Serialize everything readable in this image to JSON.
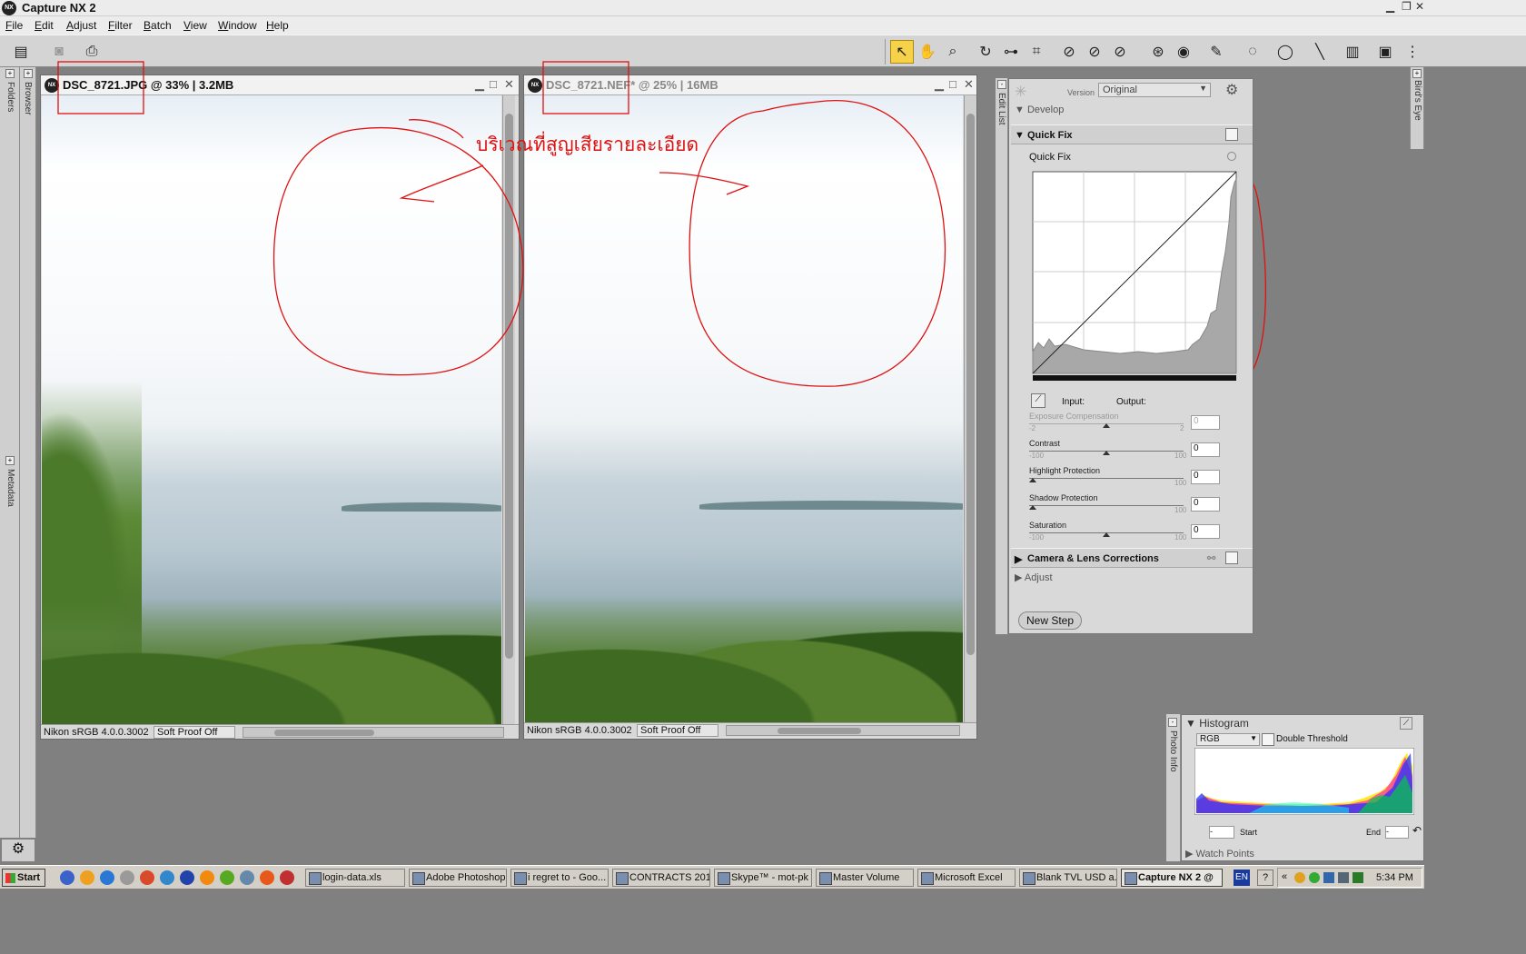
{
  "app": {
    "title": "Capture NX 2"
  },
  "menu": [
    "File",
    "Edit",
    "Adjust",
    "Filter",
    "Batch",
    "View",
    "Window",
    "Help"
  ],
  "side_panels": {
    "folders": "Folders",
    "browser": "Browser",
    "metadata": "Metadata",
    "edit_list": "Edit List",
    "birds_eye": "Bird's Eye",
    "photo_info": "Photo Info"
  },
  "window1": {
    "title": "DSC_8721.JPG @ 33% | 3.2MB",
    "profile": "Nikon sRGB 4.0.0.3002",
    "soft_proof": "Soft Proof Off"
  },
  "window2": {
    "title": "DSC_8721.NEF* @ 25% | 16MB",
    "profile": "Nikon sRGB 4.0.0.3002",
    "soft_proof": "Soft Proof Off"
  },
  "annotation_text": "บริเวณที่สูญเสียรายละเอียด",
  "edit": {
    "version_label": "Version",
    "version_value": "Original",
    "develop": "Develop",
    "quick_fix_header": "Quick Fix",
    "quick_fix_sub": "Quick Fix",
    "input_label": "Input:",
    "output_label": "Output:",
    "sliders": [
      {
        "label": "Exposure Compensation",
        "min": "-2",
        "max": "2",
        "value": "0",
        "pos": 0.5,
        "disabled": true
      },
      {
        "label": "Contrast",
        "min": "-100",
        "max": "100",
        "value": "0",
        "pos": 0.5,
        "disabled": false
      },
      {
        "label": "Highlight Protection",
        "min": "",
        "max": "100",
        "value": "0",
        "pos": 0.0,
        "disabled": false
      },
      {
        "label": "Shadow Protection",
        "min": "",
        "max": "100",
        "value": "0",
        "pos": 0.0,
        "disabled": false
      },
      {
        "label": "Saturation",
        "min": "-100",
        "max": "100",
        "value": "0",
        "pos": 0.5,
        "disabled": false
      }
    ],
    "camera_lens": "Camera & Lens Corrections",
    "adjust": "Adjust",
    "new_step": "New Step"
  },
  "histogram": {
    "title": "Histogram",
    "channel": "RGB",
    "double_threshold": "Double Threshold",
    "start_label": "Start",
    "end_label": "End",
    "start_value": "-",
    "end_value": "-",
    "watch_points": "Watch Points"
  },
  "taskbar": {
    "start": "Start",
    "tasks": [
      "login-data.xls",
      "Adobe Photoshop",
      "i regret to - Goo...",
      "CONTRACTS 2011",
      "Skype™ - mot-pk",
      "Master Volume",
      "Microsoft Excel",
      "Blank TVL USD a...",
      "Capture NX 2 @"
    ],
    "lang": "EN",
    "time": "5:34 PM"
  }
}
